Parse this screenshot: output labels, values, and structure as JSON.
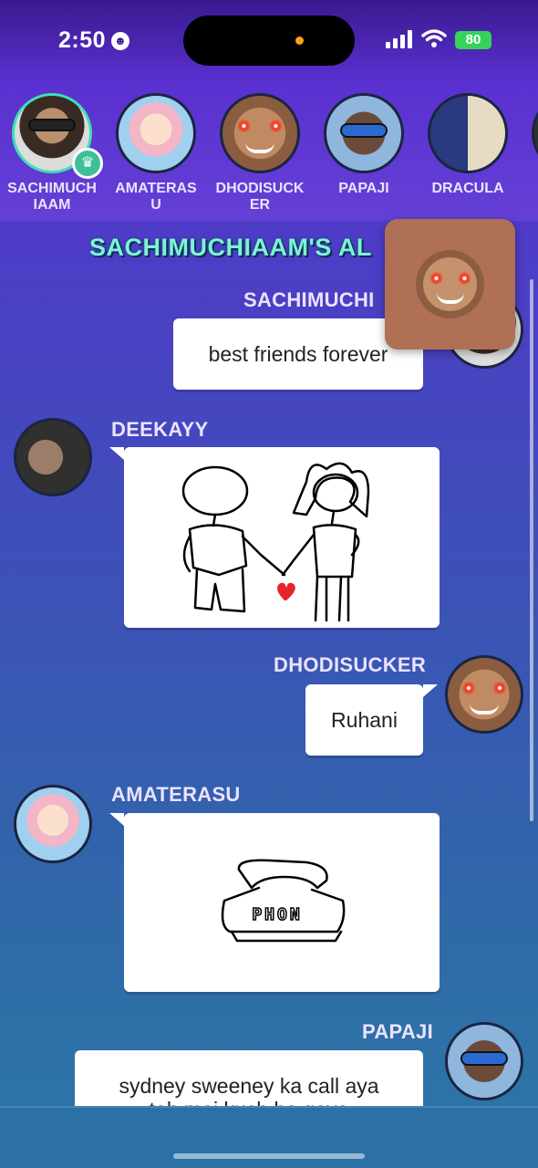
{
  "status": {
    "time": "2:50",
    "battery": "80"
  },
  "players": [
    {
      "name": "SACHIMUCHIAAM",
      "active": true,
      "crown": true
    },
    {
      "name": "AMATERASU"
    },
    {
      "name": "DHODISUCKER"
    },
    {
      "name": "PAPAJI"
    },
    {
      "name": "DRACULA"
    }
  ],
  "album": {
    "title": "SACHIMUCHIAAM'S AL"
  },
  "messages": [
    {
      "author": "SACHIMUCHI",
      "text": "best friends forever",
      "side": "right"
    },
    {
      "author": "DEEKAYY",
      "drawing": "couple-holding-hands",
      "side": "left"
    },
    {
      "author": "DHODISUCKER",
      "text": "Ruhani",
      "side": "right"
    },
    {
      "author": "AMATERASU",
      "drawing": "phone",
      "drawing_text": "PHON",
      "side": "left"
    },
    {
      "author": "PAPAJI",
      "text": "sydney sweeney ka call aya\ntoh mai kuch bo gaya",
      "side": "right"
    }
  ],
  "icons": {
    "crown": "crown-icon",
    "heart": "heart-icon",
    "battery": "battery-icon",
    "wifi": "wifi-icon",
    "signal": "cellular-signal-icon"
  },
  "colors": {
    "accent_title": "#7df3d2",
    "active_ring": "#3de0b4",
    "battery": "#35d35a",
    "heart": "#e8232b"
  }
}
